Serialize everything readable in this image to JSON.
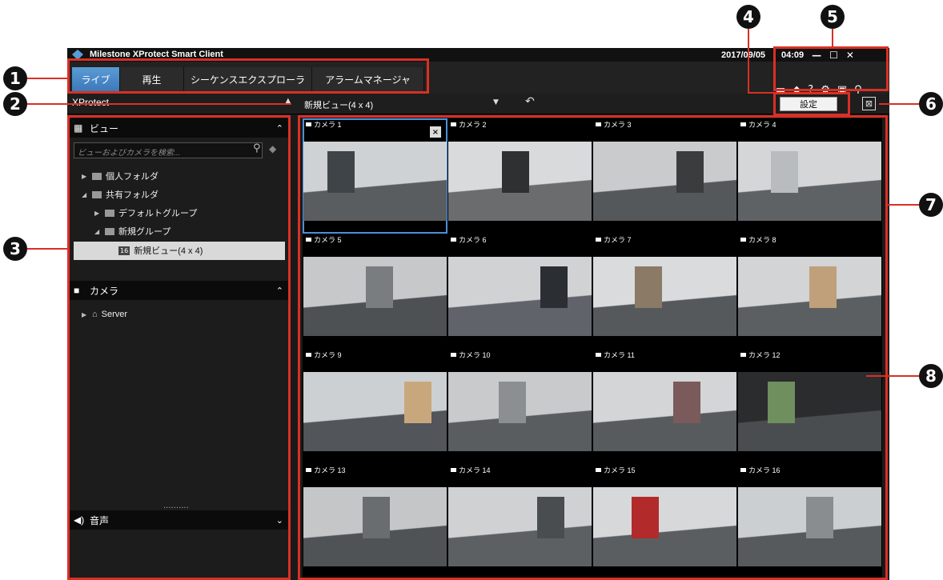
{
  "window": {
    "title": "Milestone XProtect Smart Client",
    "date": "2017/09/05",
    "time": "04:09",
    "controls": [
      "—",
      "☐",
      "✕"
    ]
  },
  "tabs": [
    {
      "label": "ライブ",
      "active": true
    },
    {
      "label": "再生",
      "active": false
    },
    {
      "label": "シーケンスエクスプローラ",
      "active": false
    },
    {
      "label": "アラームマネージャ",
      "active": false
    }
  ],
  "toolbar": {
    "icons": [
      "disconnect-icon",
      "status-icon",
      "help-icon",
      "gear-icon",
      "window-icon",
      "pin-icon"
    ]
  },
  "viewbar": {
    "left_title": "XProtect",
    "view_name": "新規ビュー(4 x 4)",
    "settings_label": "設定"
  },
  "left_panel": {
    "views_header": "ビュー",
    "search_placeholder": "ビューおよびカメラを検索...",
    "tree": [
      {
        "label": "個人フォルダ",
        "level": 0,
        "expanded": false
      },
      {
        "label": "共有フォルダ",
        "level": 0,
        "expanded": true
      },
      {
        "label": "デフォルトグループ",
        "level": 1,
        "expanded": false
      },
      {
        "label": "新規グループ",
        "level": 1,
        "expanded": true
      }
    ],
    "selected_view": "新規ビュー(4 x 4)",
    "selected_badge": "16",
    "cameras_header": "カメラ",
    "server_label": "Server",
    "dots": "..........",
    "audio_header": "音声"
  },
  "callouts": [
    "1",
    "2",
    "3",
    "4",
    "5",
    "6",
    "7",
    "8"
  ],
  "cameras": [
    {
      "label": "カメラ 1",
      "wall": "#cfd2d4",
      "floor": "#5a5d60",
      "accent": "#3f4448"
    },
    {
      "label": "カメラ 2",
      "wall": "#d8dadc",
      "floor": "#6a6c6e",
      "accent": "#2e3032"
    },
    {
      "label": "カメラ 3",
      "wall": "#c9cbcd",
      "floor": "#55585b",
      "accent": "#3a3c3e"
    },
    {
      "label": "カメラ 4",
      "wall": "#d4d6d8",
      "floor": "#5f6265",
      "accent": "#b9bcbe"
    },
    {
      "label": "カメラ 5",
      "wall": "#c6c8ca",
      "floor": "#4e5154",
      "accent": "#7a7d80"
    },
    {
      "label": "カメラ 6",
      "wall": "#d0d2d4",
      "floor": "#60636a",
      "accent": "#2b2e33"
    },
    {
      "label": "カメラ 7",
      "wall": "#d9dbdd",
      "floor": "#56595c",
      "accent": "#8a7a66"
    },
    {
      "label": "カメラ 8",
      "wall": "#d2d4d6",
      "floor": "#5c5f62",
      "accent": "#bfa07a"
    },
    {
      "label": "カメラ 9",
      "wall": "#cdd0d2",
      "floor": "#52555a",
      "accent": "#c9a77c"
    },
    {
      "label": "カメラ 10",
      "wall": "#c8cacc",
      "floor": "#5a5d60",
      "accent": "#8c8f92"
    },
    {
      "label": "カメラ 11",
      "wall": "#d3d5d7",
      "floor": "#585b5e",
      "accent": "#7a5a5a"
    },
    {
      "label": "カメラ 12",
      "wall": "#2a2c2e",
      "floor": "#4a4d50",
      "accent": "#6f8f5f"
    },
    {
      "label": "カメラ 13",
      "wall": "#c4c6c8",
      "floor": "#505356",
      "accent": "#6a6d70"
    },
    {
      "label": "カメラ 14",
      "wall": "#cfd1d3",
      "floor": "#5d6063",
      "accent": "#4a4d50"
    },
    {
      "label": "カメラ 15",
      "wall": "#d6d8da",
      "floor": "#5b5e61",
      "accent": "#b22a2a"
    },
    {
      "label": "カメラ 16",
      "wall": "#cccfd1",
      "floor": "#575a5d",
      "accent": "#8a8d90"
    }
  ]
}
